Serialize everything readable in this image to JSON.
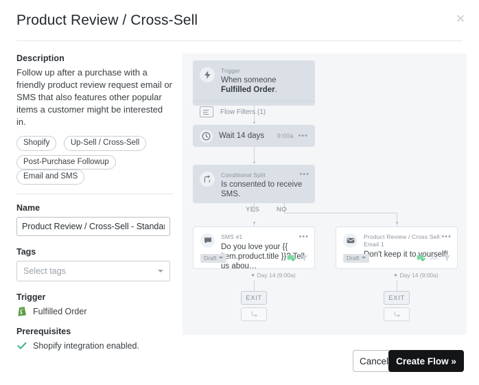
{
  "modal": {
    "title": "Product Review / Cross-Sell",
    "close_icon": "close-icon"
  },
  "left": {
    "description_label": "Description",
    "description_text": "Follow up after a purchase with a friendly product review request email or SMS that also features other popular items a customer might be interested in.",
    "tags_row1": [
      "Shopify",
      "Up-Sell / Cross-Sell"
    ],
    "tags_row2": [
      "Post-Purchase Followup",
      "Email and SMS"
    ],
    "name_label": "Name",
    "name_value": "Product Review / Cross-Sell - Standard (Em",
    "tags_label": "Tags",
    "tags_placeholder": "Select tags",
    "trigger_label": "Trigger",
    "trigger_value": "Fulfilled Order",
    "prerequisites_label": "Prerequisites",
    "prerequisites_value": "Shopify integration enabled."
  },
  "flow": {
    "trigger": {
      "kicker": "Trigger",
      "text_prefix": "When someone ",
      "text_bold": "Fulfilled Order",
      "text_suffix": ".",
      "filters_label": "Flow Filters (1)"
    },
    "wait": {
      "label": "Wait 14 days",
      "time": "9:00a",
      "menu": "•••"
    },
    "split": {
      "kicker": "Conditional Split",
      "text": "Is consented to receive SMS.",
      "menu": "•••",
      "yes_label": "YES",
      "no_label": "NO"
    },
    "sms": {
      "kicker": "SMS #1",
      "subject": "Do you love your {{ item.product.title }}? Tell us abou…",
      "status": "Draft",
      "menu": "•••",
      "day_tag": "✦ Day 14 (9:00a)"
    },
    "email": {
      "kicker": "Product Review / Cross Sell: Email 1",
      "subject": "Don't keep it to yourself!",
      "status": "Draft",
      "menu": "•••",
      "day_tag": "✦ Day 14 (9:00a)"
    },
    "exit_left_label": "EXIT",
    "exit_right_label": "EXIT"
  },
  "footer": {
    "cancel_label": "Cancel",
    "create_label": "Create Flow »"
  },
  "colors": {
    "canvas_bg": "#f4f6f8",
    "node_bg": "#dbe0e6",
    "primary_button": "#131516",
    "shopify_green": "#5b9a3f",
    "check_green": "#36b37e",
    "sms_icon_green": "#7ed9a4"
  }
}
